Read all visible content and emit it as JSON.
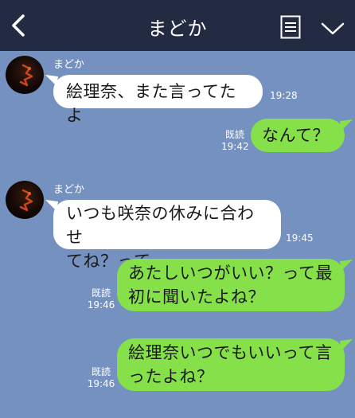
{
  "header": {
    "title": "まどか"
  },
  "icons": {
    "back": "chevron-left-icon",
    "notes": "note-icon",
    "menu": "chevron-down-icon"
  },
  "colors": {
    "header_bg": "#232b43",
    "chat_bg": "#7591c0",
    "incoming": "#ffffff",
    "outgoing": "#86e04a"
  },
  "messages": [
    {
      "sender": "まどか",
      "direction": "in",
      "text": "絵理奈、また言ってたよ",
      "time": "19:28"
    },
    {
      "direction": "out",
      "text": "なんて？",
      "read": "既読",
      "time": "19:42"
    },
    {
      "sender": "まどか",
      "direction": "in",
      "lines": [
        "いつも咲奈の休みに合わせ",
        "てね？って"
      ],
      "time": "19:45"
    },
    {
      "direction": "out",
      "lines": [
        "あたしいつがいい？って最",
        "初に聞いたよね？"
      ],
      "read": "既読",
      "time": "19:46"
    },
    {
      "direction": "out",
      "lines": [
        "絵理奈いつでもいいって言",
        "ったよね？"
      ],
      "read": "既読",
      "time": "19:46"
    }
  ]
}
